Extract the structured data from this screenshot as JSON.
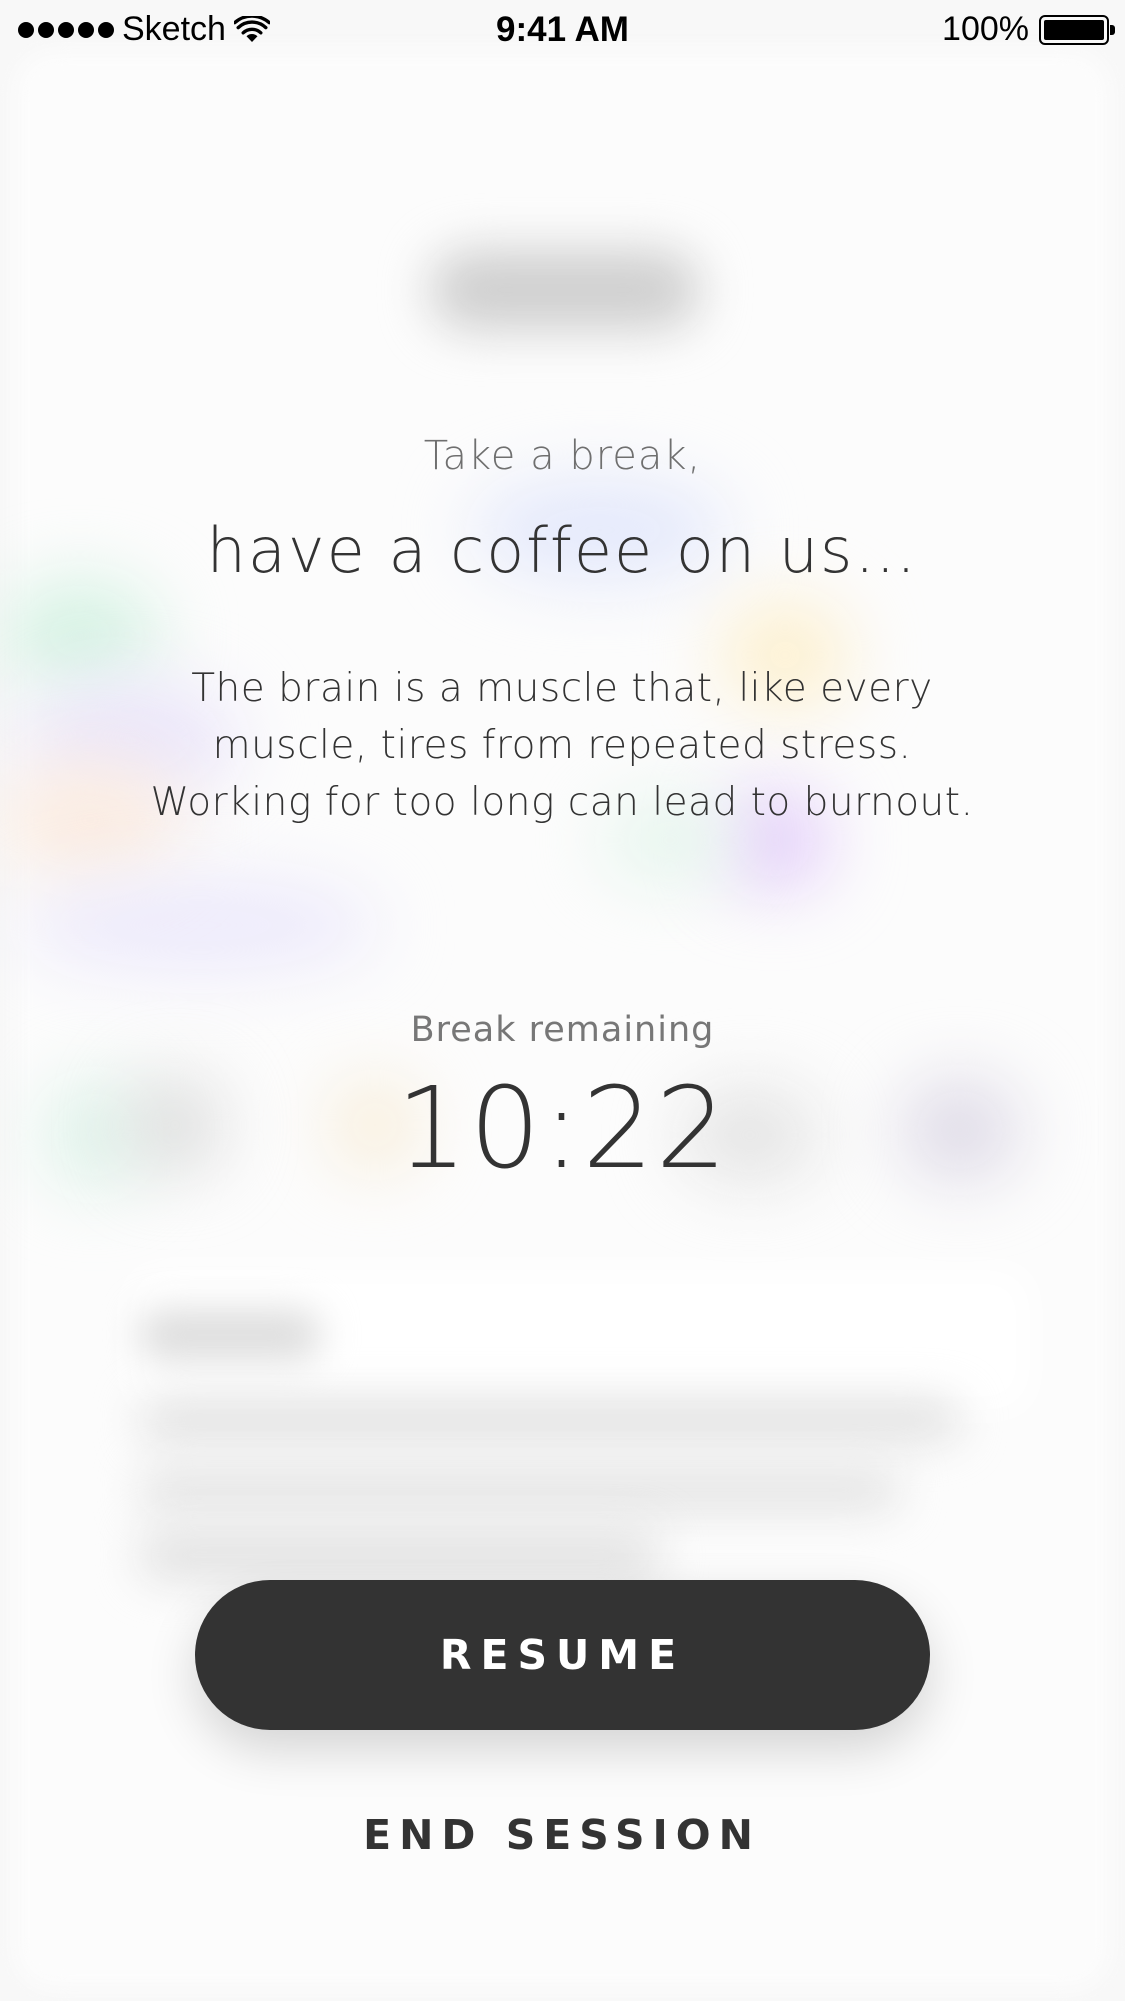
{
  "status_bar": {
    "carrier": "Sketch",
    "time": "9:41 AM",
    "battery": "100%",
    "battery_level": 1.0,
    "signal_dots": 5
  },
  "break_screen": {
    "subtitle": "Take a break,",
    "heading": "have a coffee on us…",
    "body_lines": [
      "The brain is a muscle that, like every",
      "muscle, tires from repeated stress.",
      "Working for too long can lead to burnout."
    ],
    "timer_label": "Break remaining",
    "timer_value": "10:22"
  },
  "actions": {
    "resume_label": "RESUME",
    "end_session_label": "END SESSION"
  },
  "colors": {
    "background": "#f8f8f8",
    "text_dark": "#333333",
    "text_muted": "#6f6f6f",
    "button_dark": "#333333",
    "button_text": "#ffffff"
  }
}
